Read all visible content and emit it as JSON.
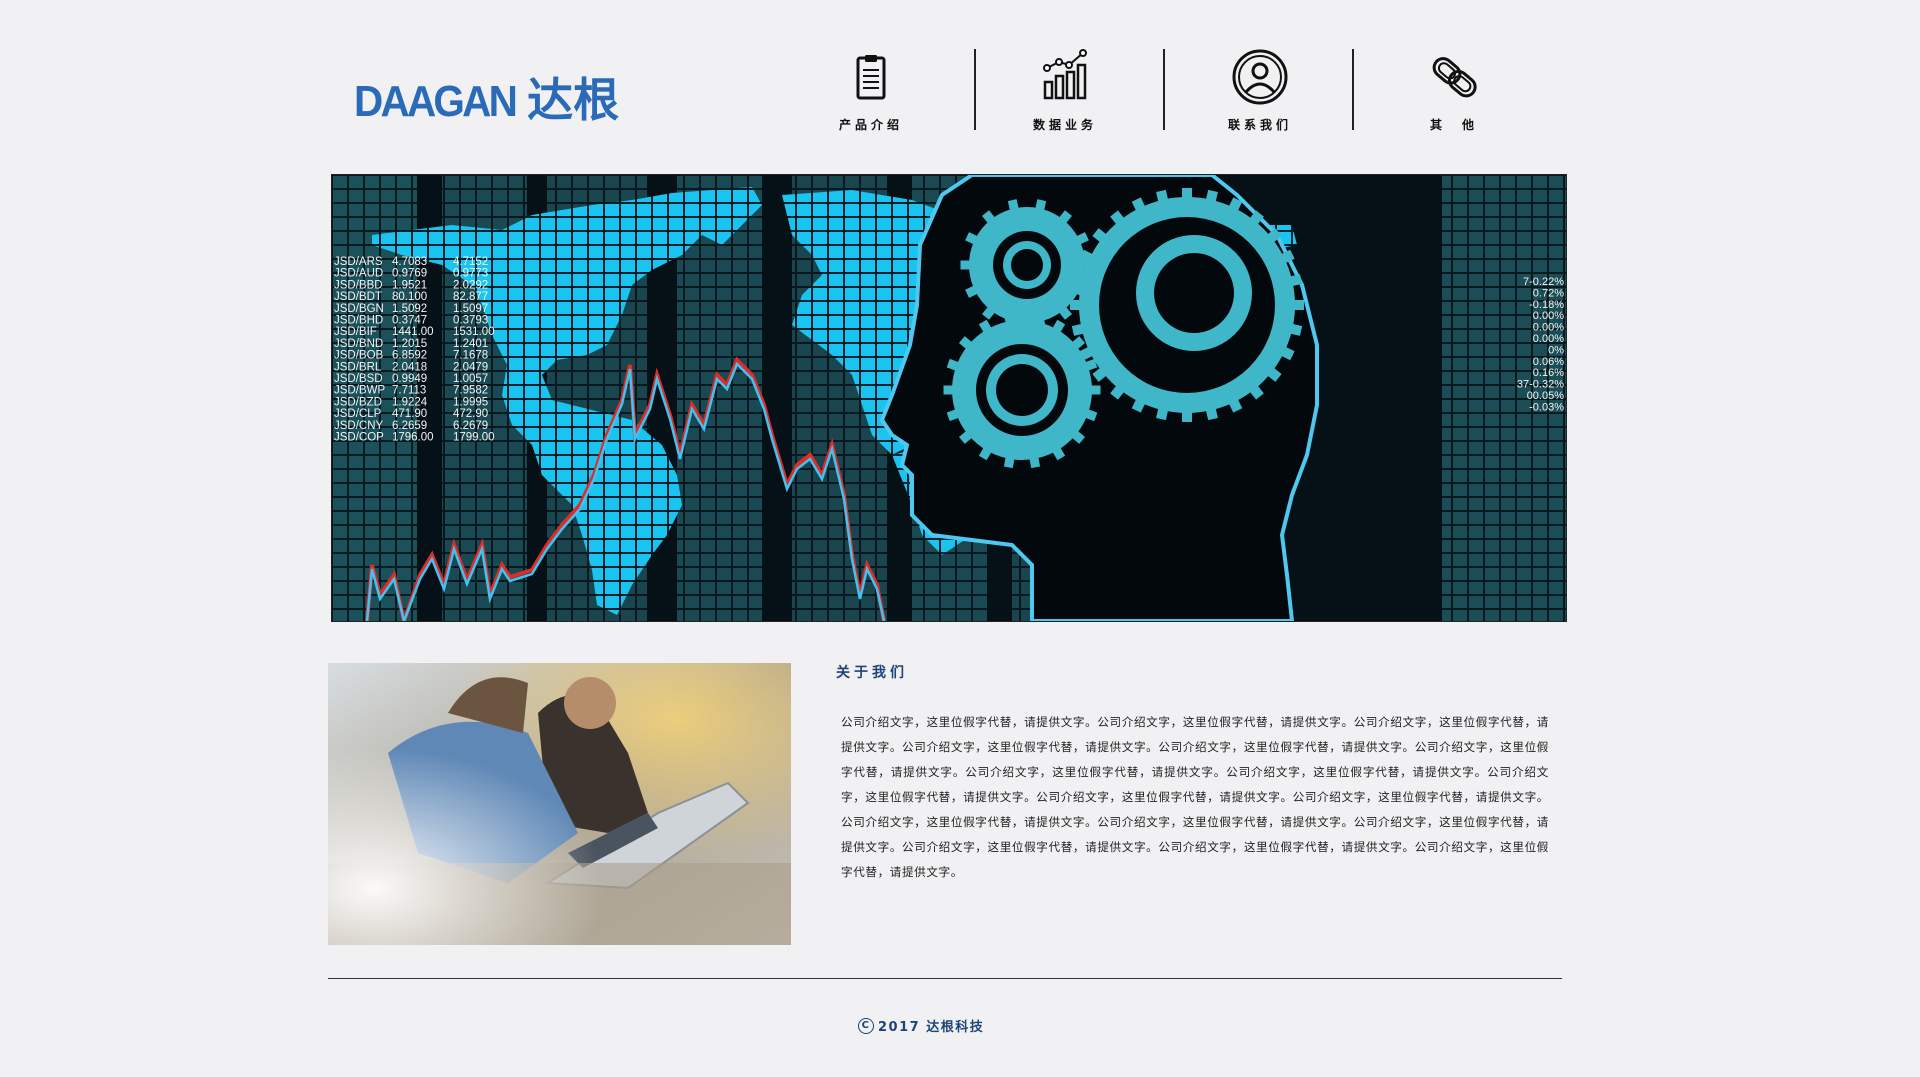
{
  "header": {
    "logo_latin": "DAAGAN",
    "logo_cjk": "达根",
    "nav": [
      {
        "label": "产品介绍",
        "icon": "clipboard-icon"
      },
      {
        "label": "数据业务",
        "icon": "bar-chart-icon"
      },
      {
        "label": "联系我们",
        "icon": "user-circle-icon"
      },
      {
        "label": "其　他",
        "icon": "link-icon"
      }
    ]
  },
  "banner": {
    "ticker": [
      {
        "pair": "JSD/ARS",
        "bid": "4.7083",
        "ask": "4.7152"
      },
      {
        "pair": "JSD/AUD",
        "bid": "0.9769",
        "ask": "0.9773"
      },
      {
        "pair": "JSD/BBD",
        "bid": "1.9521",
        "ask": "2.0292"
      },
      {
        "pair": "JSD/BDT",
        "bid": "80.100",
        "ask": "82.877"
      },
      {
        "pair": "JSD/BGN",
        "bid": "1.5092",
        "ask": "1.5097"
      },
      {
        "pair": "JSD/BHD",
        "bid": "0.3747",
        "ask": "0.3793"
      },
      {
        "pair": "JSD/BIF",
        "bid": "1441.00",
        "ask": "1531.00"
      },
      {
        "pair": "JSD/BND",
        "bid": "1.2015",
        "ask": "1.2401"
      },
      {
        "pair": "JSD/BOB",
        "bid": "6.8592",
        "ask": "7.1678"
      },
      {
        "pair": "JSD/BRL",
        "bid": "2.0418",
        "ask": "2.0479"
      },
      {
        "pair": "JSD/BSD",
        "bid": "0.9949",
        "ask": "1.0057"
      },
      {
        "pair": "JSD/BWP",
        "bid": "7.7113",
        "ask": "7.9582"
      },
      {
        "pair": "JSD/BZD",
        "bid": "1.9224",
        "ask": "1.9995"
      },
      {
        "pair": "JSD/CLP",
        "bid": "471.90",
        "ask": "472.90"
      },
      {
        "pair": "JSD/CNY",
        "bid": "6.2659",
        "ask": "6.2679"
      },
      {
        "pair": "JSD/COP",
        "bid": "1796.00",
        "ask": "1799.00"
      }
    ],
    "right_values": [
      "7-0.22%",
      "0.72%",
      "-0.18%",
      "0.00%",
      "0.00%",
      "0.00%",
      "0%",
      "0.06%",
      "0.16%",
      "37-0.32%",
      "00.05%",
      "-0.03%"
    ]
  },
  "about": {
    "title": "关于我们",
    "text": "公司介绍文字，这里位假字代替，请提供文字。公司介绍文字，这里位假字代替，请提供文字。公司介绍文字，这里位假字代替，请提供文字。公司介绍文字，这里位假字代替，请提供文字。公司介绍文字，这里位假字代替，请提供文字。公司介绍文字，这里位假字代替，请提供文字。公司介绍文字，这里位假字代替，请提供文字。公司介绍文字，这里位假字代替，请提供文字。公司介绍文字，这里位假字代替，请提供文字。公司介绍文字，这里位假字代替，请提供文字。公司介绍文字，这里位假字代替，请提供文字。公司介绍文字，这里位假字代替，请提供文字。公司介绍文字，这里位假字代替，请提供文字。公司介绍文字，这里位假字代替，请提供文字。公司介绍文字，这里位假字代替，请提供文字。公司介绍文字，这里位假字代替，请提供文字。公司介绍文字，这里位假字代替，请提供文字。"
  },
  "footer": {
    "copyright_symbol": "C",
    "text": "2017 达根科技"
  },
  "colors": {
    "brand": "#2a6ab6",
    "accent_dark": "#1c4476",
    "banner_cyan": "#19c4f0",
    "gear": "#3fb7c9"
  }
}
